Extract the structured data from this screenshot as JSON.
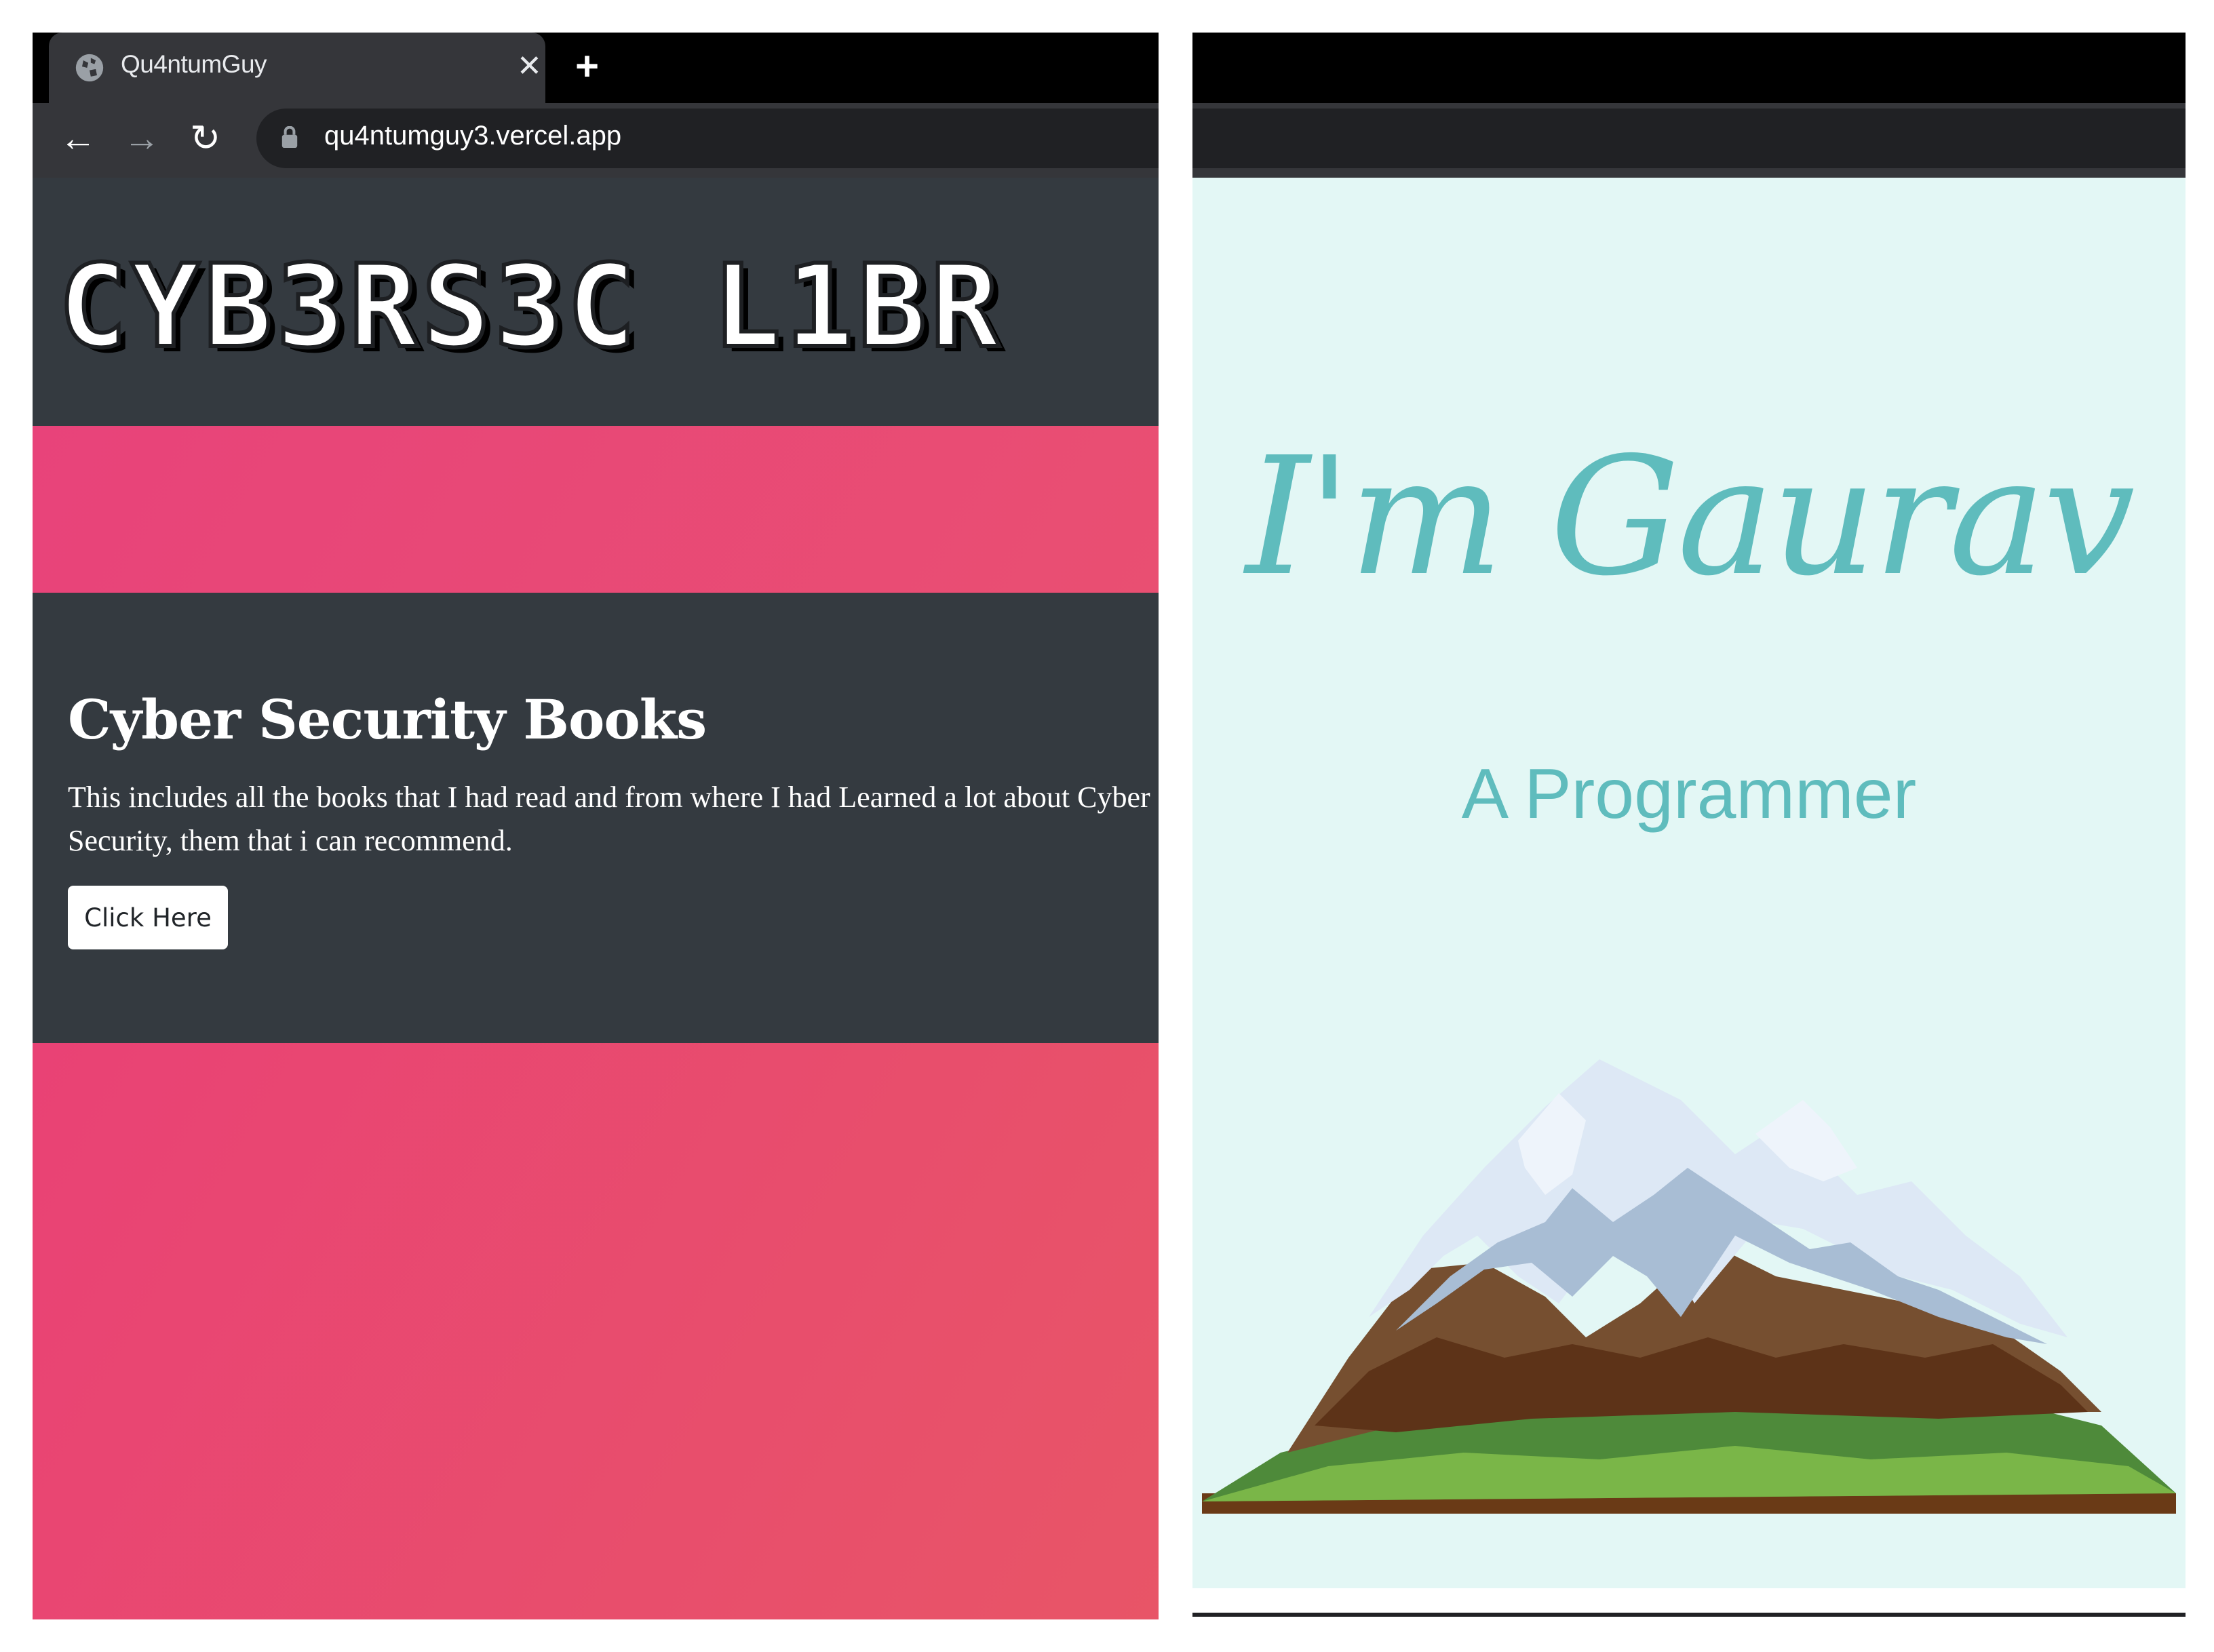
{
  "left_browser": {
    "tab": {
      "title": "Qu4ntumGuy",
      "close_glyph": "✕",
      "globe_icon": "globe-icon"
    },
    "new_tab_glyph": "+",
    "nav": {
      "back_glyph": "←",
      "forward_glyph": "→",
      "reload_glyph": "↻"
    },
    "address": {
      "url": "qu4ntumguy3.vercel.app",
      "lock_icon": "lock-icon"
    },
    "page": {
      "brand": "CYB3RS3C L1BR",
      "section_title": "Cyber Security Books",
      "section_desc": "This includes all the books that I had read and from where I had Learned a lot about Cyber Security, them that i can recommend.",
      "button_label": "Click Here"
    },
    "colors": {
      "dark": "#343a40",
      "pink": "#e8437a"
    }
  },
  "right_browser": {
    "page": {
      "hero_name": "I'm Gaurav",
      "hero_role": "A Programmer",
      "illustration": "mountain-illustration"
    },
    "colors": {
      "background": "#e3f7f5",
      "accent": "#5fbcbd"
    }
  }
}
